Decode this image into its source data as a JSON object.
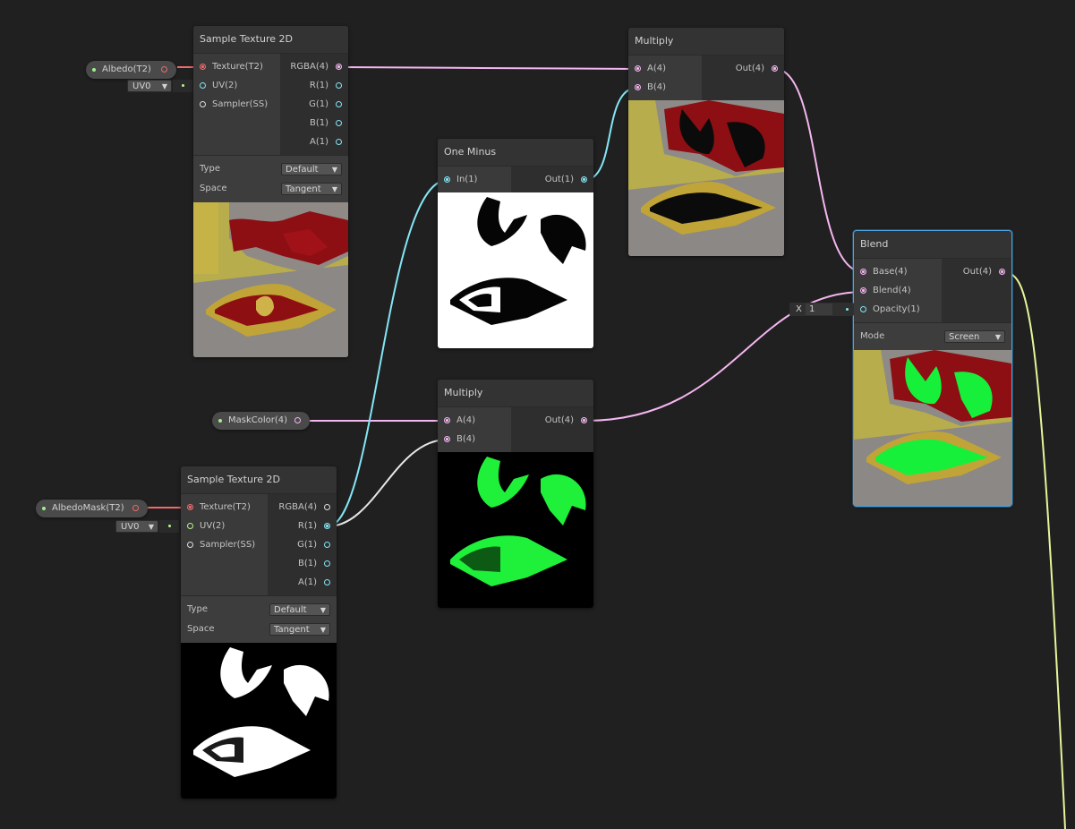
{
  "colors": {
    "background": "#202020",
    "node": "#393939",
    "selection": "#4aa3df",
    "texture_port": "#f0696b",
    "vector4_port": "#f5b6f0",
    "vector1_port": "#84e6f5",
    "uv_port": "#b8f58a",
    "final_wire": "#e8f59a"
  },
  "properties": {
    "albedo": {
      "label": "Albedo(T2)"
    },
    "mask_color": {
      "label": "MaskColor(4)"
    },
    "albedo_mask": {
      "label": "AlbedoMask(T2)"
    },
    "uv_channel_1": "UV0",
    "uv_channel_2": "UV0"
  },
  "nodes": {
    "sample_texture_1": {
      "title": "Sample Texture 2D",
      "inputs": [
        "Texture(T2)",
        "UV(2)",
        "Sampler(SS)"
      ],
      "outputs": [
        "RGBA(4)",
        "R(1)",
        "G(1)",
        "B(1)",
        "A(1)"
      ],
      "type_label": "Type",
      "type_value": "Default",
      "space_label": "Space",
      "space_value": "Tangent"
    },
    "multiply_top": {
      "title": "Multiply",
      "inputs": [
        "A(4)",
        "B(4)"
      ],
      "outputs": [
        "Out(4)"
      ]
    },
    "one_minus": {
      "title": "One Minus",
      "inputs": [
        "In(1)"
      ],
      "outputs": [
        "Out(1)"
      ]
    },
    "blend": {
      "title": "Blend",
      "inputs": [
        "Base(4)",
        "Blend(4)",
        "Opacity(1)"
      ],
      "outputs": [
        "Out(4)"
      ],
      "mode_label": "Mode",
      "mode_value": "Screen",
      "opacity_x_label": "X",
      "opacity_value": "1"
    },
    "multiply_mid": {
      "title": "Multiply",
      "inputs": [
        "A(4)",
        "B(4)"
      ],
      "outputs": [
        "Out(4)"
      ]
    },
    "sample_texture_2": {
      "title": "Sample Texture 2D",
      "inputs": [
        "Texture(T2)",
        "UV(2)",
        "Sampler(SS)"
      ],
      "outputs": [
        "RGBA(4)",
        "R(1)",
        "G(1)",
        "B(1)",
        "A(1)"
      ],
      "type_label": "Type",
      "type_value": "Default",
      "space_label": "Space",
      "space_value": "Tangent"
    }
  }
}
